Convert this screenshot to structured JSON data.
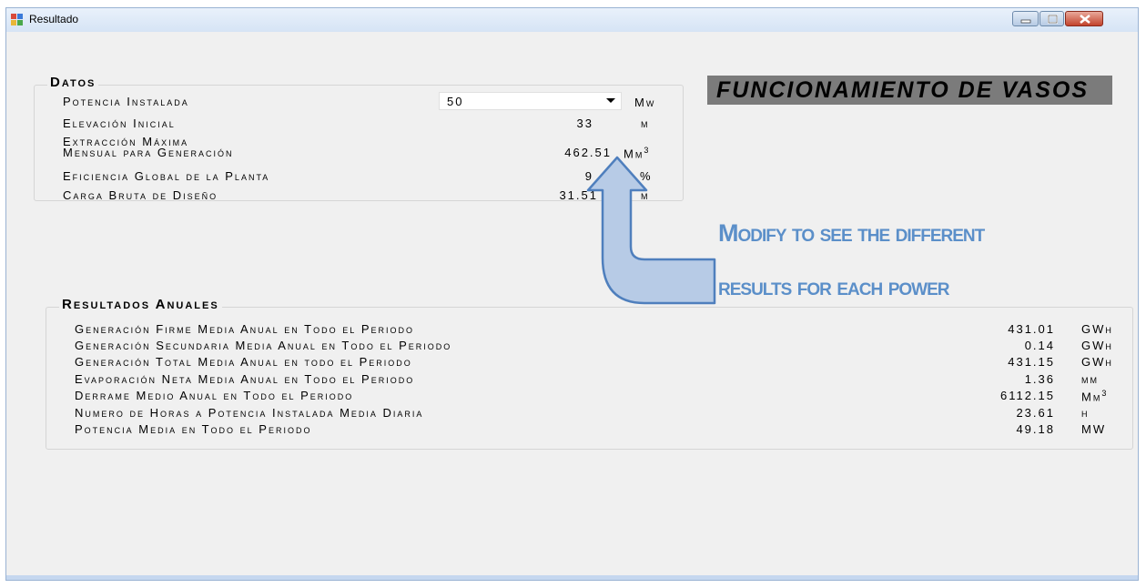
{
  "window": {
    "title": "Resultado",
    "icon": "app-window-icon"
  },
  "datos": {
    "title": "Datos",
    "potencia": {
      "label": "Potencia Instalada",
      "value": "50",
      "unit": "Mw"
    },
    "elevacion": {
      "label": "Elevación Inicial",
      "value": "33",
      "unit": "m"
    },
    "extraccion": {
      "label1": "Extracción Máxima",
      "label2": "Mensual para Generación",
      "value": "462.51",
      "unit": "Mm"
    },
    "eficiencia": {
      "label": "Eficiencia Global de la Planta",
      "value": "9",
      "unit": "%"
    },
    "carga": {
      "label": "Carga Bruta de Diseño",
      "value": "31.51",
      "unit": "m"
    }
  },
  "banner": "FUNCIONAMIENTO DE VASOS",
  "note": {
    "line1": "Modify to see the different",
    "line2": "results for each power"
  },
  "resultados": {
    "title": "Resultados Anuales",
    "rows": [
      {
        "label": "Generación Firme Media Anual en Todo el Periodo",
        "value": "431.01",
        "unit": "GWh"
      },
      {
        "label": "Generación Secundaria Media Anual en Todo el Periodo",
        "value": "0.14",
        "unit": "GWh"
      },
      {
        "label": "Generación Total Media Anual en todo el Periodo",
        "value": "431.15",
        "unit": "GWh"
      },
      {
        "label": "Evaporación Neta Media Anual en Todo el Periodo",
        "value": "1.36",
        "unit": "mm"
      },
      {
        "label": "Derrame Medio Anual en Todo el Periodo",
        "value": "6112.15",
        "unit": "Mm"
      },
      {
        "label": "Numero de Horas a Potencia Instalada Media Diaria",
        "value": "23.61",
        "unit": "h"
      },
      {
        "label": "Potencia Media en Todo el Periodo",
        "value": "49.18",
        "unit": "MW"
      }
    ]
  }
}
